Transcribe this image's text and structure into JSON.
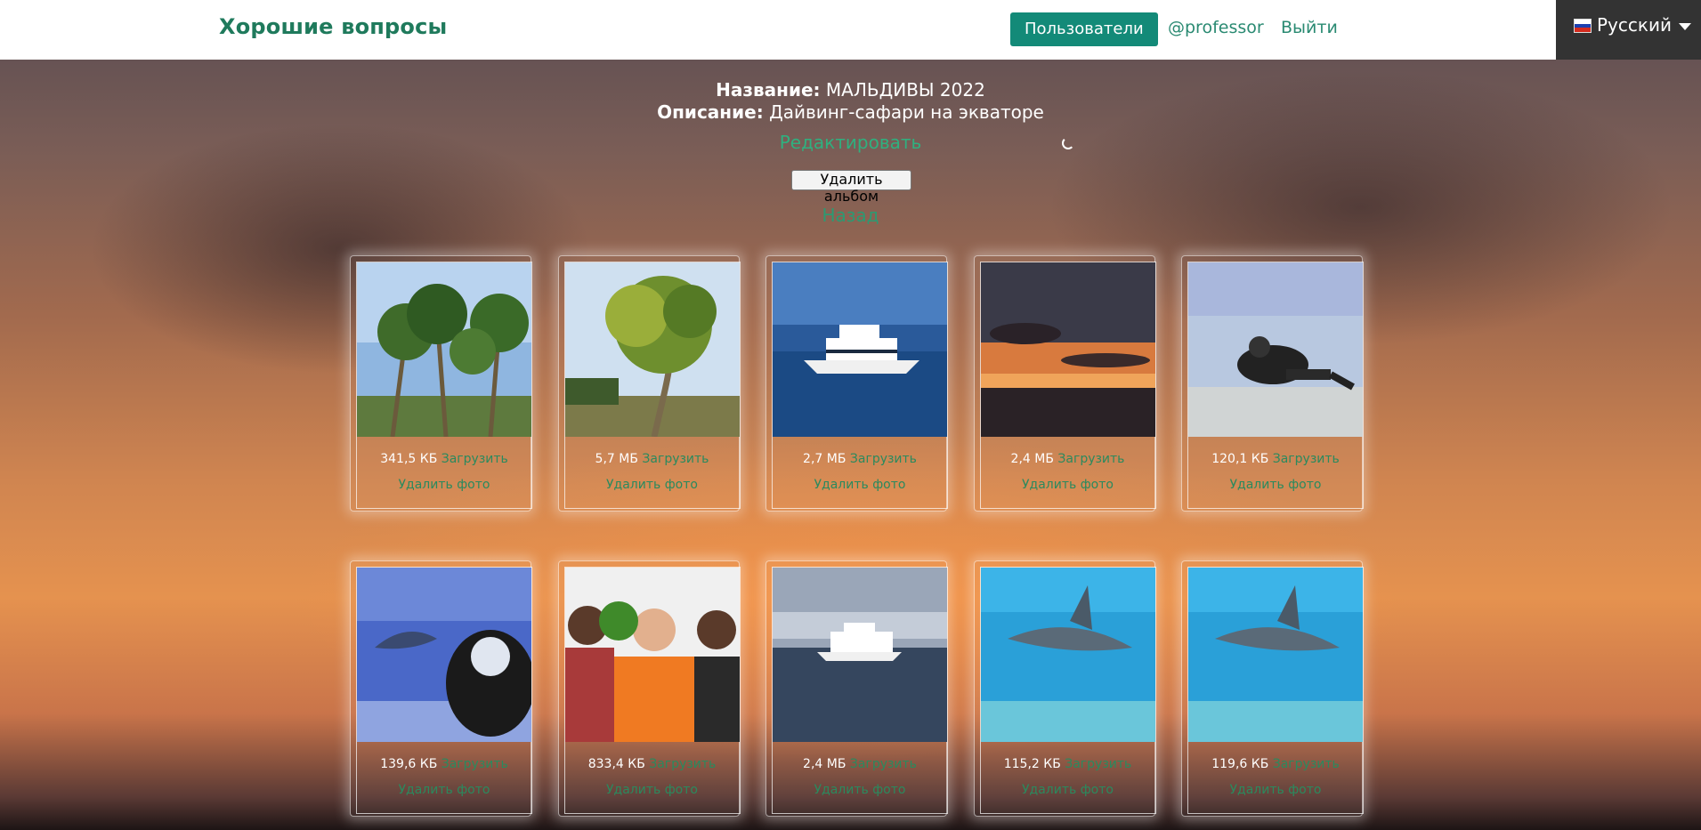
{
  "navbar": {
    "brand": "Хорошие вопросы",
    "users_button": "Пользователи",
    "username": "@professor",
    "logout": "Выйти"
  },
  "language": {
    "label": "Русский",
    "flag_icon": "russia-flag-icon"
  },
  "album": {
    "name_label": "Название:",
    "name_value": "МАЛЬДИВЫ 2022",
    "desc_label": "Описание:",
    "desc_value": "Дайвинг-сафари на экваторе",
    "edit": "Редактировать",
    "delete_album": "Удалить альбом",
    "back": "Назад"
  },
  "photos": [
    {
      "size": "341,5 КБ",
      "upload": "Загрузить",
      "delete": "Удалить фото",
      "scene": "palms"
    },
    {
      "size": "5,7 МБ",
      "upload": "Загрузить",
      "delete": "Удалить фото",
      "scene": "palm-single"
    },
    {
      "size": "2,7 МБ",
      "upload": "Загрузить",
      "delete": "Удалить фото",
      "scene": "yacht"
    },
    {
      "size": "2,4 МБ",
      "upload": "Загрузить",
      "delete": "Удалить фото",
      "scene": "sunset"
    },
    {
      "size": "120,1 КБ",
      "upload": "Загрузить",
      "delete": "Удалить фото",
      "scene": "diver"
    },
    {
      "size": "139,6 КБ",
      "upload": "Загрузить",
      "delete": "Удалить фото",
      "scene": "manta"
    },
    {
      "size": "833,4 КБ",
      "upload": "Загрузить",
      "delete": "Удалить фото",
      "scene": "people"
    },
    {
      "size": "2,4 МБ",
      "upload": "Загрузить",
      "delete": "Удалить фото",
      "scene": "yacht-calm"
    },
    {
      "size": "115,2 КБ",
      "upload": "Загрузить",
      "delete": "Удалить фото",
      "scene": "shark"
    },
    {
      "size": "119,6 КБ",
      "upload": "Загрузить",
      "delete": "Удалить фото",
      "scene": "shark"
    }
  ],
  "colors": {
    "brand": "#1f7a5c",
    "button": "#138a78",
    "link": "#2a8a5e"
  }
}
